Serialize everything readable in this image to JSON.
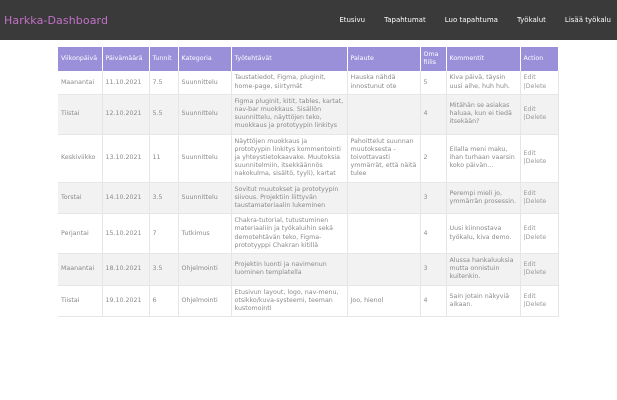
{
  "app": {
    "brand": "Harkka-Dashboard",
    "nav": [
      "Etusivu",
      "Tapahtumat",
      "Luo tapahtuma",
      "Työkalut",
      "Lisää työkalu"
    ]
  },
  "table": {
    "headers": [
      "Viikonpäivä",
      "Päivämäärä",
      "Tunnit",
      "Kategoria",
      "Työtehtävät",
      "Palaute",
      "Oma fiilis",
      "Kommentit",
      "Action"
    ],
    "rows": [
      {
        "day": "Maanantai",
        "date": "11.10.2021",
        "hours": "7.5",
        "category": "Suunnittelu",
        "tasks": "Taustatiedot, Figma, pluginit, home-page, siirtymät",
        "feedback": "Hauska nähdä innostunut ote",
        "mood": "5",
        "comments": "Kiva päivä, täysin uusi aihe, huh huh.",
        "edit": "Edit",
        "delete": "|Delete"
      },
      {
        "day": "Tiistai",
        "date": "12.10.2021",
        "hours": "5.5",
        "category": "Suunnittelu",
        "tasks": "Figma pluginit, kitit, tables, kartat, nav-bar muokkaus. Sisällön suunnittelu, näyttöjen teko, muokkaus ja prototyypin linkitys",
        "feedback": "",
        "mood": "4",
        "comments": "Mitähän se asiakas haluaa, kun ei tiedä itsekään?",
        "edit": "Edit",
        "delete": "|Delete"
      },
      {
        "day": "Keskiviikko",
        "date": "13.10.2021",
        "hours": "11",
        "category": "Suunnittelu",
        "tasks": "Näyttöjen muokkaus ja prototyypin linkitys kommentointi ja yhteystietokaavake. Muutoksia suunnitelmiin, itsekkäännös nakokulma, sisältö, tyyli), kartat",
        "feedback": "Pahoittelut suunnan muutoksesta - toivottavasti ymmärrät, että näitä tulee",
        "mood": "2",
        "comments": "Eilalla meni maku, ihan turhaan vaarsin koko päivän...",
        "edit": "Edit",
        "delete": "|Delete"
      },
      {
        "day": "Torstai",
        "date": "14.10.2021",
        "hours": "3.5",
        "category": "Suunnittelu",
        "tasks": "Sovitut muutokset ja prototyypin siivous. Projektiin liittyvän taustamateriaalin lukeminen",
        "feedback": "",
        "mood": "3",
        "comments": "Perempi mieli jo, ymmärrän prosessin.",
        "edit": "Edit",
        "delete": "|Delete"
      },
      {
        "day": "Perjantai",
        "date": "15.10.2021",
        "hours": "7",
        "category": "Tutkimus",
        "tasks": "Chakra-tutorial, tutustuminen materiaaliin ja työkaluihin sekä demotehtävän teko, Figma-prototyyppi Chakran kitillä",
        "feedback": "",
        "mood": "4",
        "comments": "Uusi kiinnostava työkalu, kiva demo.",
        "edit": "Edit",
        "delete": "|Delete"
      },
      {
        "day": "Maanantai",
        "date": "18.10.2021",
        "hours": "3.5",
        "category": "Ohjelmointi",
        "tasks": "Projektin luonti ja navimenun luominen templatella",
        "feedback": "",
        "mood": "3",
        "comments": "Alussa hankaluuksia mutta onnistuin kuitenkin.",
        "edit": "Edit",
        "delete": "|Delete"
      },
      {
        "day": "Tiistai",
        "date": "19.10.2021",
        "hours": "6",
        "category": "Ohjelmointi",
        "tasks": "Etusivun layout, logo, nav-menu, otsikko/kuva-systeemi, teeman kustomointi",
        "feedback": "Joo, hienol",
        "mood": "4",
        "comments": "Sain jotain näkyviä aikaan.",
        "edit": "Edit",
        "delete": "|Delete"
      }
    ]
  }
}
